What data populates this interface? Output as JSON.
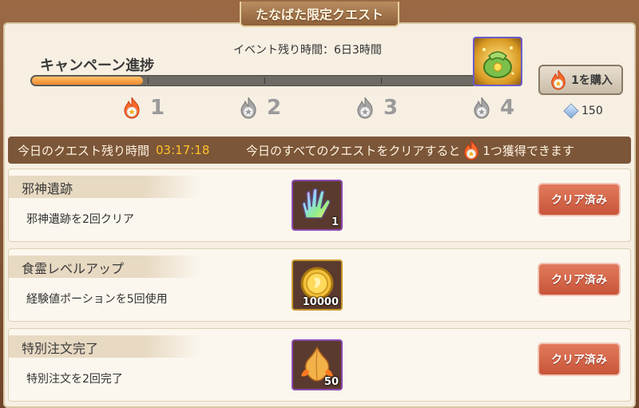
{
  "title": "たなばた限定クエスト",
  "event_timer": "イベント残り時間：6日3時間",
  "campaign": {
    "label": "キャンペーン進捗",
    "progress_fraction": 0.25,
    "milestones": [
      "1",
      "2",
      "3",
      "4"
    ]
  },
  "buy_button": {
    "label": "1を購入"
  },
  "gem_count": "150",
  "daily": {
    "left_label": "今日のクエスト残り時間",
    "time": "03:17:18",
    "right_text_pre": "今日のすべてのクエストをクリアすると",
    "right_text_post": "1つ獲得できます"
  },
  "quests": [
    {
      "title": "邪神遺跡",
      "desc": "邪神遺跡を2回クリア",
      "qty": "1",
      "button": "クリア済み"
    },
    {
      "title": "食霊レベルアップ",
      "desc": "経験値ポーションを5回使用",
      "qty": "10000",
      "button": "クリア済み"
    },
    {
      "title": "特別注文完了",
      "desc": "特別注文を2回完了",
      "qty": "50",
      "button": "クリア済み"
    }
  ],
  "colors": {
    "accent_orange": "#f0882c",
    "timer_yellow": "#ffc12a",
    "clear_button": "#d0603f"
  }
}
